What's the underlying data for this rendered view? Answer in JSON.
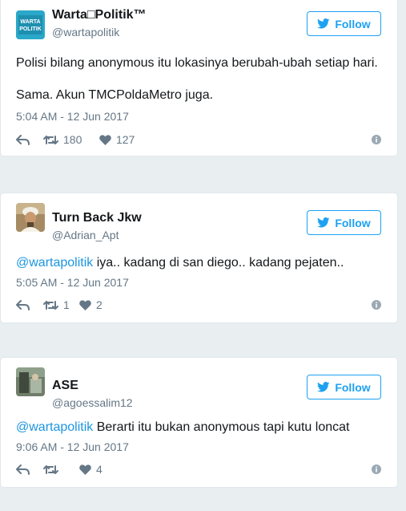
{
  "follow_label": "Follow",
  "colors": {
    "brand": "#1da1f2",
    "link": "#1b95e0",
    "muted": "#657786"
  },
  "tweets": [
    {
      "name": "Warta□Politik™",
      "handle": "@wartapolitik",
      "avatar_icon": "warta-politik-logo",
      "avatar_text": [
        "WARTA",
        "POLITIK"
      ],
      "text": [
        "Polisi bilang anonymous itu lokasinya berubah-ubah setiap hari.",
        "Sama. Akun TMCPoldaMetro juga."
      ],
      "time": "5:04 AM - 12 Jun 2017",
      "retweets": "180",
      "likes": "127"
    },
    {
      "name": "Turn Back Jkw",
      "handle": "@Adrian_Apt",
      "avatar_icon": "portrait-avatar",
      "mention": "@wartapolitik",
      "text": " iya.. kadang di san diego.. kadang pejaten..",
      "time": "5:05 AM - 12 Jun 2017",
      "retweets": "1",
      "likes": "2"
    },
    {
      "name": "ASE",
      "handle": "@agoessalim12",
      "avatar_icon": "photo-avatar",
      "mention": "@wartapolitik",
      "text": " Berarti itu bukan anonymous tapi kutu loncat",
      "time": "9:06 AM - 12 Jun 2017",
      "retweets": "",
      "likes": "4"
    }
  ]
}
